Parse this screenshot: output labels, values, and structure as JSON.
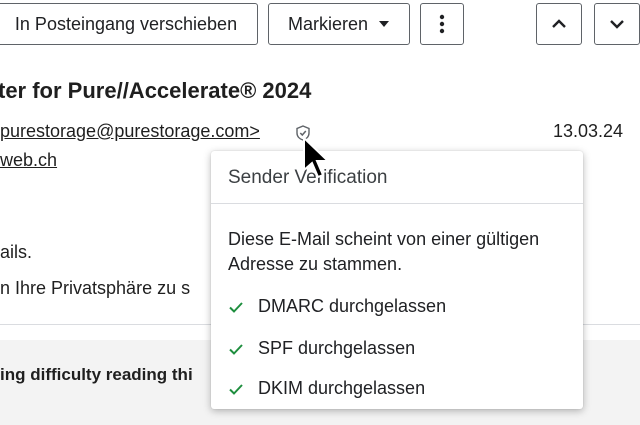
{
  "toolbar": {
    "move_to_inbox_label": "In Posteingang verschieben",
    "mark_label": "Markieren",
    "more_icon": "more-vert-icon",
    "prev_icon": "chevron-up-icon",
    "next_icon": "chevron-down-icon"
  },
  "message": {
    "subject": "ter for Pure//Accelerate® 2024",
    "from": "purestorage@purestorage.com>",
    "date": "13.03.24",
    "to": "web.ch",
    "body_line1": "ails.",
    "body_line2": "n Ihre Privatsphäre zu s",
    "body_line3": "ing difficulty reading thi"
  },
  "verification_popup": {
    "title": "Sender Verification",
    "description": "Diese E-Mail scheint von einer gültigen Adresse zu stammen.",
    "checks": [
      {
        "label": "DMARC durchgelassen"
      },
      {
        "label": "SPF durchgelassen"
      },
      {
        "label": "DKIM durchgelassen"
      }
    ],
    "check_color": "#1e8e3e"
  }
}
